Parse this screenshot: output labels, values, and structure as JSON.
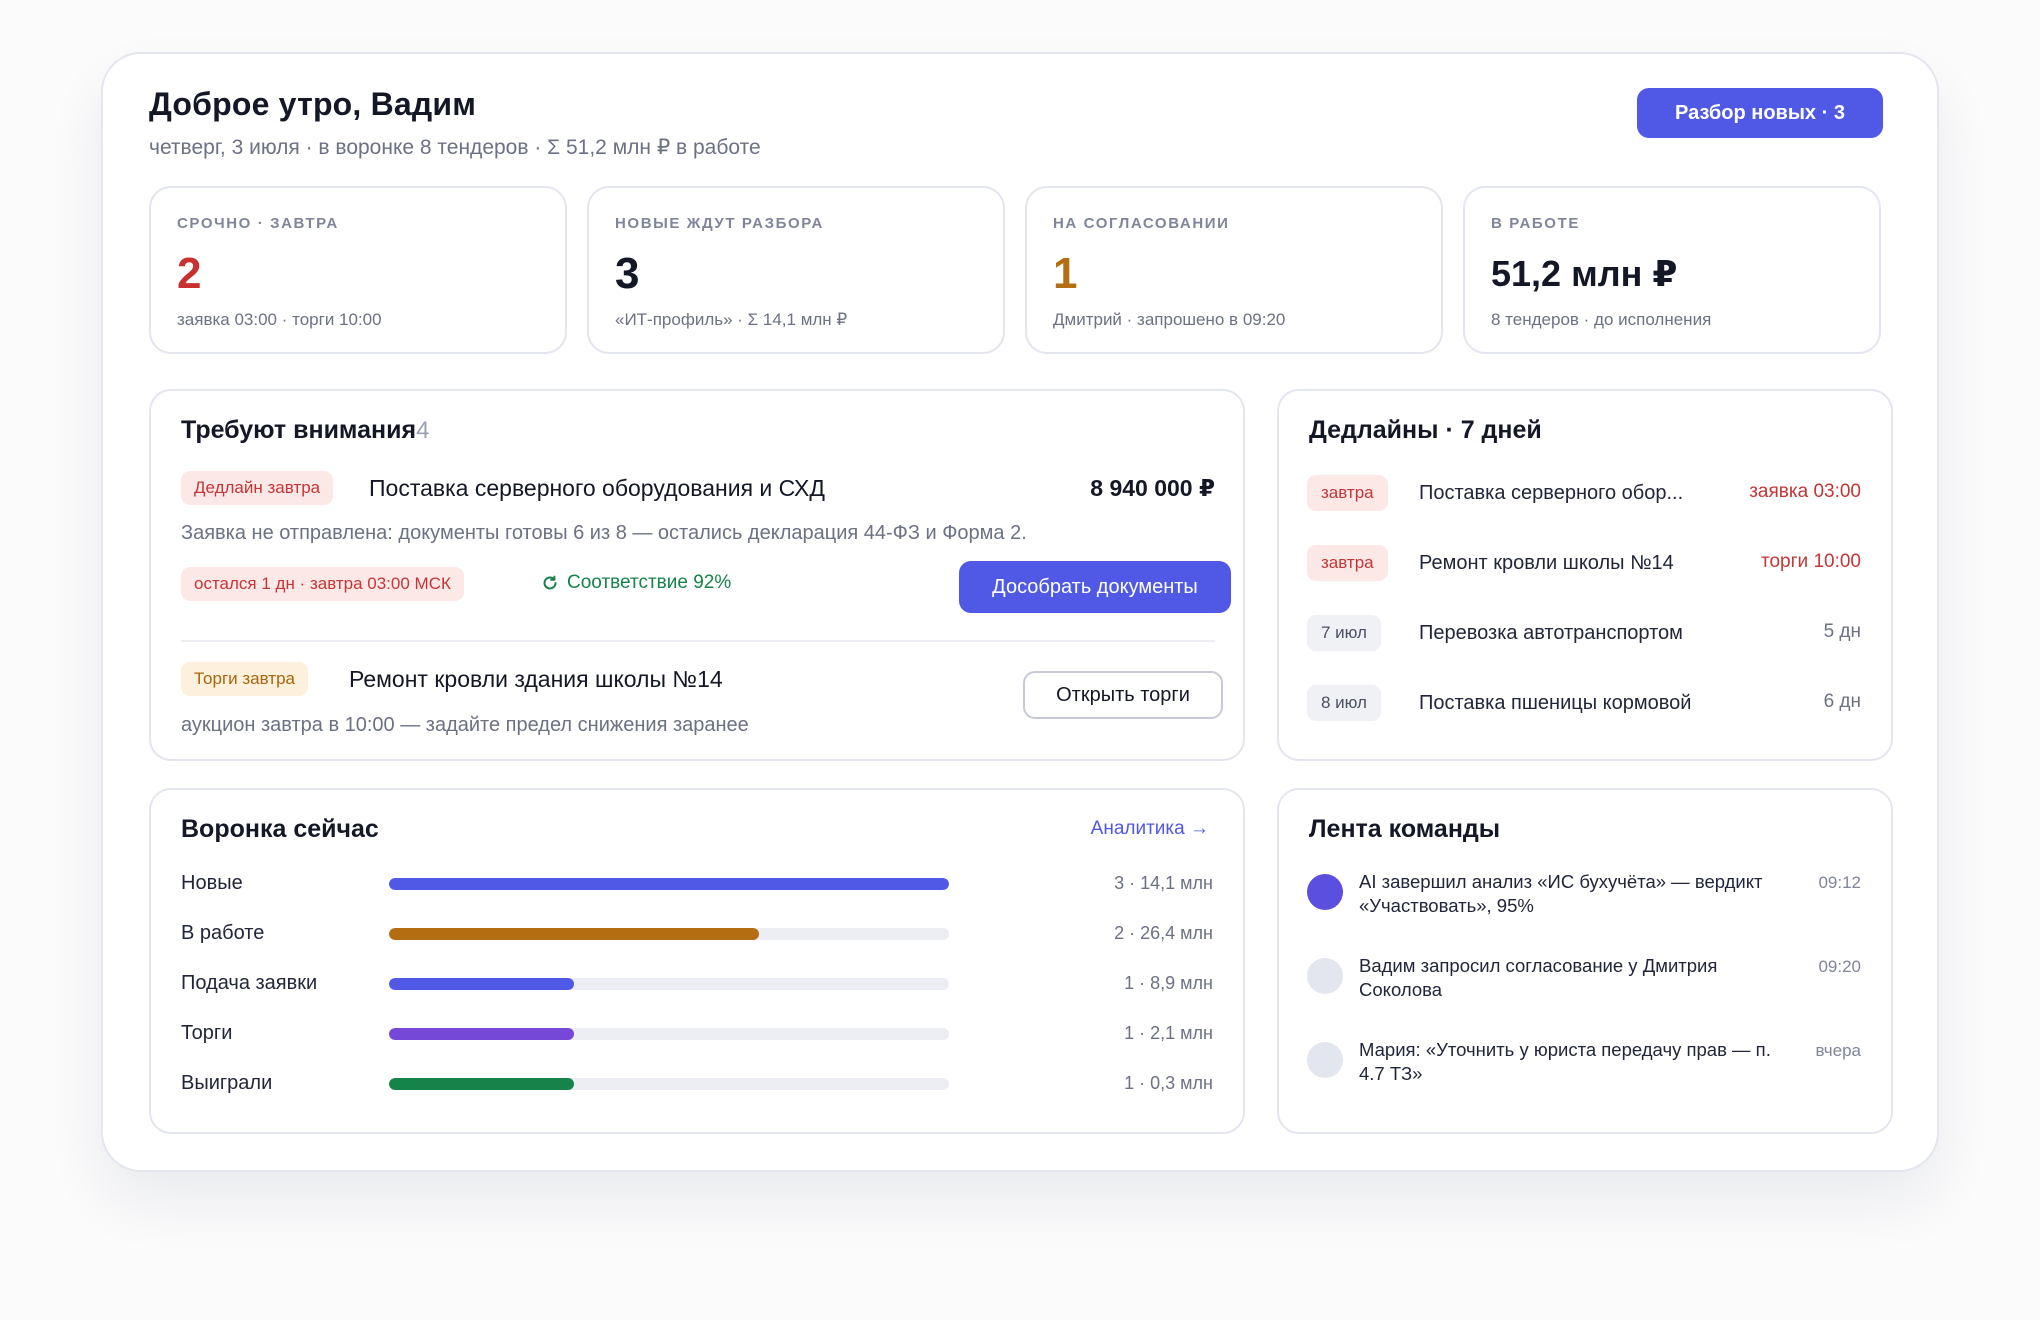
{
  "header": {
    "greeting": "Доброе утро, Вадим",
    "subline": "четверг, 3 июля · в воронке 8 тендеров · Σ 51,2 млн ₽ в работе",
    "cta_label": "Разбор новых · 3"
  },
  "stats": [
    {
      "label": "СРОЧНО · ЗАВТРА",
      "value": "2",
      "sub": "заявка 03:00 · торги 10:00",
      "color": "#c93030"
    },
    {
      "label": "НОВЫЕ ЖДУТ РАЗБОРА",
      "value": "3",
      "sub": "«ИТ-профиль» · Σ 14,1 млн ₽",
      "color": "#141726"
    },
    {
      "label": "НА СОГЛАСОВАНИИ",
      "value": "1",
      "sub": "Дмитрий · запрошено в 09:20",
      "color": "#b56d12"
    },
    {
      "label": "В РАБОТЕ",
      "value": "51,2 млн ₽",
      "sub": "8 тендеров · до исполнения",
      "color": "#141726"
    }
  ],
  "attention": {
    "title": "Требуют внимания",
    "count": "4",
    "items": [
      {
        "badge": "Дедлайн завтра",
        "title": "Поставка серверного оборудования и СХД",
        "amount": "8 940 000 ₽",
        "description": "Заявка не отправлена: документы готовы 6 из 8 — остались декларация 44-ФЗ и Форма 2.",
        "timer_badge": "остался 1 дн · завтра 03:00 МСК",
        "match": "Соответствие 92%",
        "action": "Дособрать документы"
      },
      {
        "badge": "Торги завтра",
        "title": "Ремонт кровли здания школы №14",
        "description": "аукцион завтра в 10:00 — задайте предел снижения заранее",
        "action": "Открыть торги"
      }
    ]
  },
  "deadlines": {
    "title": "Дедлайны · 7 дней",
    "rows": [
      {
        "badge": "завтра",
        "name": "Поставка серверного обор...",
        "when": "заявка 03:00",
        "urgent": true
      },
      {
        "badge": "завтра",
        "name": "Ремонт кровли школы №14",
        "when": "торги 10:00",
        "urgent": true
      },
      {
        "badge": "7 июл",
        "name": "Перевозка автотранспортом",
        "when": "5 дн",
        "urgent": false
      },
      {
        "badge": "8 июл",
        "name": "Поставка пшеницы кормовой",
        "when": "6 дн",
        "urgent": false
      }
    ]
  },
  "funnel": {
    "title": "Воронка сейчас",
    "link": "Аналитика →",
    "rows": [
      {
        "label": "Новые",
        "value": "3 · 14,1 млн",
        "fill": 1.0,
        "color": "#4f59e6"
      },
      {
        "label": "В работе",
        "value": "2 · 26,4 млн",
        "fill": 0.66,
        "color": "#b56d12"
      },
      {
        "label": "Подача заявки",
        "value": "1 · 8,9 млн",
        "fill": 0.33,
        "color": "#4f59e6"
      },
      {
        "label": "Торги",
        "value": "1 · 2,1 млн",
        "fill": 0.33,
        "color": "#7548d8"
      },
      {
        "label": "Выиграли",
        "value": "1 · 0,3 млн",
        "fill": 0.33,
        "color": "#16834a"
      }
    ]
  },
  "feed": {
    "title": "Лента команды",
    "items": [
      {
        "text": "AI завершил анализ «ИС бухучёта» — вердикт «Участвовать», 95%",
        "time": "09:12",
        "dot": "#5b4fe0"
      },
      {
        "text": "Вадим запросил согласование у Дмитрия Соколова",
        "time": "09:20",
        "dot": "#e3e5ef"
      },
      {
        "text": "Мария: «Уточнить у юриста передачу прав — п. 4.7 ТЗ»",
        "time": "вчера",
        "dot": "#e3e5ef"
      }
    ]
  }
}
